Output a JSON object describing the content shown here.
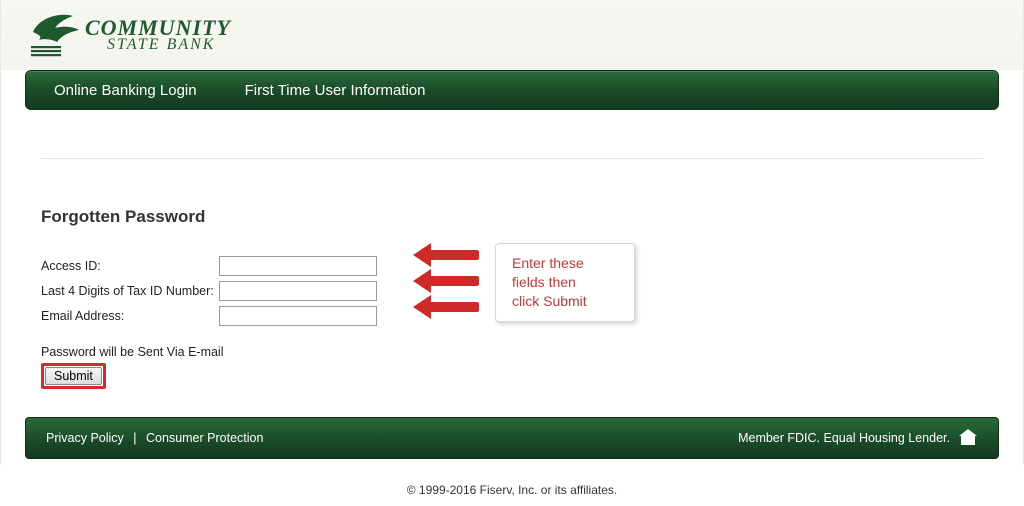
{
  "brand": {
    "name_line1": "COMMUNITY",
    "name_line2": "STATE BANK",
    "color": "#1f5a2f"
  },
  "nav": {
    "items": [
      {
        "label": "Online Banking Login"
      },
      {
        "label": "First Time User Information"
      }
    ]
  },
  "page": {
    "title": "Forgotten Password",
    "fields": {
      "access_id": {
        "label": "Access ID:",
        "value": ""
      },
      "tax_id": {
        "label": "Last 4 Digits of Tax ID Number:",
        "value": ""
      },
      "email": {
        "label": "Email Address:",
        "value": ""
      }
    },
    "note": "Password will be Sent Via E-mail",
    "submit_label": "Submit"
  },
  "annotation": {
    "text": "Enter these\nfields then\nclick Submit",
    "color": "#c83636"
  },
  "footer": {
    "links": [
      {
        "label": "Privacy Policy"
      },
      {
        "label": "Consumer Protection"
      }
    ],
    "divider": "|",
    "member_text": "Member FDIC. Equal Housing Lender."
  },
  "copyright": "© 1999-2016 Fiserv, Inc. or its affiliates."
}
